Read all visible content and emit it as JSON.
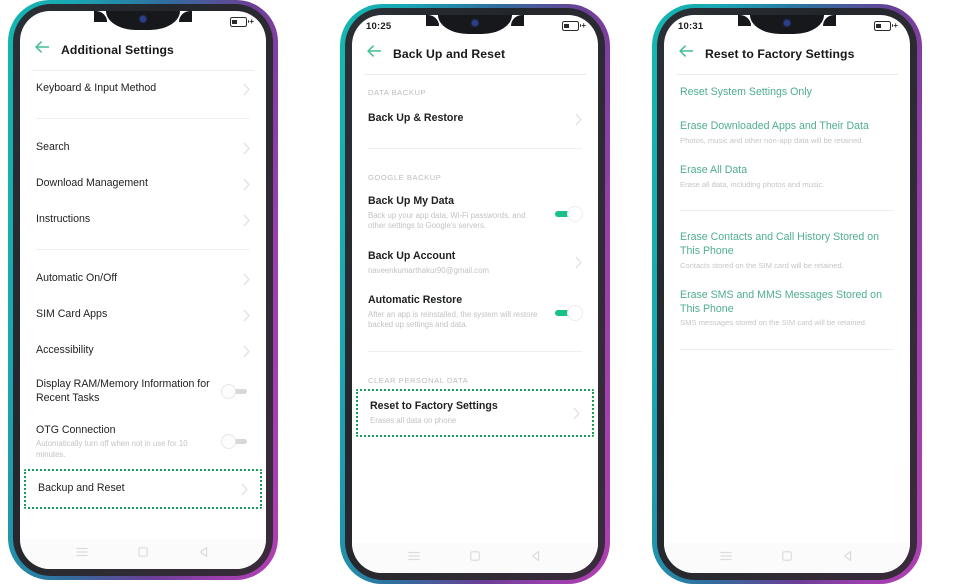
{
  "meta": {
    "accent_green": "#4fae8e",
    "highlight_border": "#169a55",
    "toggle_on_color": "#18c08a",
    "frame_gradient_start": "#12b8b0",
    "frame_gradient_end": "#b13fb0",
    "background": "#ffffff"
  },
  "phones": [
    {
      "id": "phone-additional-settings",
      "status": {
        "time": "",
        "battery_icon": "battery-icon",
        "battery_plus": "+"
      },
      "appbar": {
        "back_icon": "back-arrow-icon",
        "title": "Additional Settings"
      },
      "rows": [
        {
          "title": "Keyboard & Input Method",
          "sub": "",
          "control": "chevron"
        },
        {
          "type": "divider-tall"
        },
        {
          "title": "Search",
          "sub": "",
          "control": "chevron"
        },
        {
          "title": "Download Management",
          "sub": "",
          "control": "chevron"
        },
        {
          "title": "Instructions",
          "sub": "",
          "control": "chevron"
        },
        {
          "type": "divider-tall"
        },
        {
          "title": "Automatic On/Off",
          "sub": "",
          "control": "chevron"
        },
        {
          "title": "SIM Card Apps",
          "sub": "",
          "control": "chevron"
        },
        {
          "title": "Accessibility",
          "sub": "",
          "control": "chevron"
        },
        {
          "title": "Display RAM/Memory Information for Recent Tasks",
          "sub": "",
          "control": "toggle-off"
        },
        {
          "title": "OTG Connection",
          "sub": "Automatically turn off when not in use for 10 minutes.",
          "control": "toggle-off"
        },
        {
          "title": "Backup and Reset",
          "sub": "",
          "control": "chevron",
          "highlight": true
        }
      ],
      "navbar": {
        "recents": "menu-icon",
        "home": "home-icon",
        "back": "back-triangle-icon"
      }
    },
    {
      "id": "phone-back-up-and-reset",
      "status": {
        "time": "10:25",
        "battery_icon": "battery-icon",
        "battery_plus": "+"
      },
      "appbar": {
        "back_icon": "back-arrow-icon",
        "title": "Back Up and Reset"
      },
      "rows": [
        {
          "type": "section",
          "label": "DATA BACKUP"
        },
        {
          "title": "Back Up & Restore",
          "sub": "",
          "control": "chevron",
          "bold": true
        },
        {
          "type": "divider-tall"
        },
        {
          "type": "section",
          "label": "GOOGLE BACKUP"
        },
        {
          "title": "Back Up My Data",
          "sub": "Back up your app data, Wi-Fi passwords, and other settings to Google's servers.",
          "control": "toggle-on",
          "bold": true
        },
        {
          "title": "Back Up Account",
          "sub": "naveenkumarthakur90@gmail.com",
          "control": "chevron",
          "bold": true
        },
        {
          "title": "Automatic Restore",
          "sub": "After an app is reinstalled, the system will restore backed up settings and data.",
          "control": "toggle-on",
          "bold": true
        },
        {
          "type": "divider-tall"
        },
        {
          "type": "section",
          "label": "CLEAR PERSONAL DATA"
        },
        {
          "title": "Reset to Factory Settings",
          "sub": "Erases all data on phone",
          "control": "chevron",
          "bold": true,
          "highlight": true
        }
      ],
      "navbar": {
        "recents": "menu-icon",
        "home": "home-icon",
        "back": "back-triangle-icon"
      }
    },
    {
      "id": "phone-reset-to-factory-settings",
      "status": {
        "time": "10:31",
        "battery_icon": "battery-icon",
        "battery_plus": "+"
      },
      "appbar": {
        "back_icon": "back-arrow-icon",
        "title": "Reset to Factory Settings"
      },
      "rows": [
        {
          "title": "Reset System Settings Only",
          "sub": "",
          "control": "none",
          "green": true
        },
        {
          "title": "Erase Downloaded Apps and Their Data",
          "sub": "Photos, music and other non-app data will be retained.",
          "control": "none",
          "green": true
        },
        {
          "title": "Erase All Data",
          "sub": "Erase all data, including photos and music.",
          "control": "none",
          "green": true
        },
        {
          "type": "divider-tall"
        },
        {
          "title": "Erase Contacts and Call History Stored on This Phone",
          "sub": "Contacts stored on the SIM card will be retained.",
          "control": "none",
          "green": true
        },
        {
          "title": "Erase SMS and MMS Messages Stored on This Phone",
          "sub": "SMS messages stored on the SIM card will be retained.",
          "control": "none",
          "green": true
        },
        {
          "type": "divider-tall"
        }
      ],
      "navbar": {
        "recents": "menu-icon",
        "home": "home-icon",
        "back": "back-triangle-icon"
      }
    }
  ]
}
